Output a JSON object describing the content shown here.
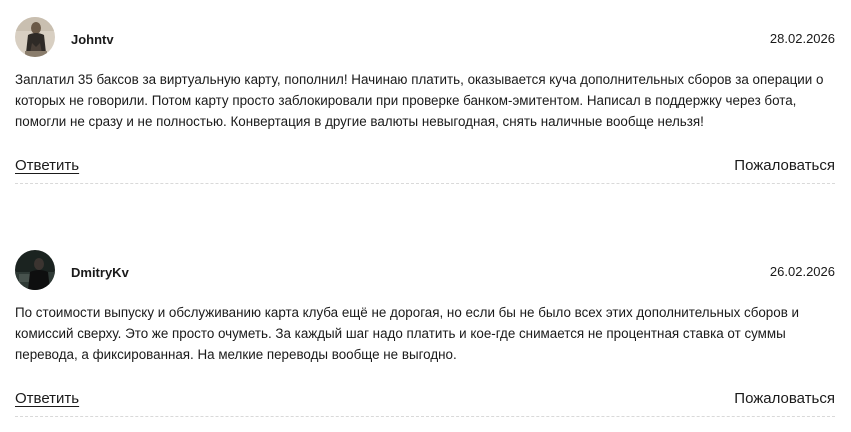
{
  "comments": [
    {
      "author": "Johntv",
      "date": "28.02.2026",
      "text": "Заплатил 35 баксов за виртуальную карту, пополнил! Начинаю платить, оказывается куча дополнительных сборов за операции о которых не говорили. Потом карту просто заблокировали при проверке банком-эмитентом. Написал в поддержку через бота, помогли не сразу и не полностью. Конвертация в другие валюты невыгодная, снять наличные вообще нельзя!",
      "reply_label": "Ответить",
      "report_label": "Пожаловаться"
    },
    {
      "author": "DmitryKv",
      "date": "26.02.2026",
      "text": "По стоимости выпуску и обслуживанию карта клуба ещё не дорогая, но если бы не было всех этих дополнительных сборов и комиссий сверху. Это же просто очуметь. За каждый шаг надо платить и кое-где снимается не процентная ставка от суммы перевода, а фиксированная. На мелкие переводы вообще не выгодно.",
      "reply_label": "Ответить",
      "report_label": "Пожаловаться"
    }
  ]
}
